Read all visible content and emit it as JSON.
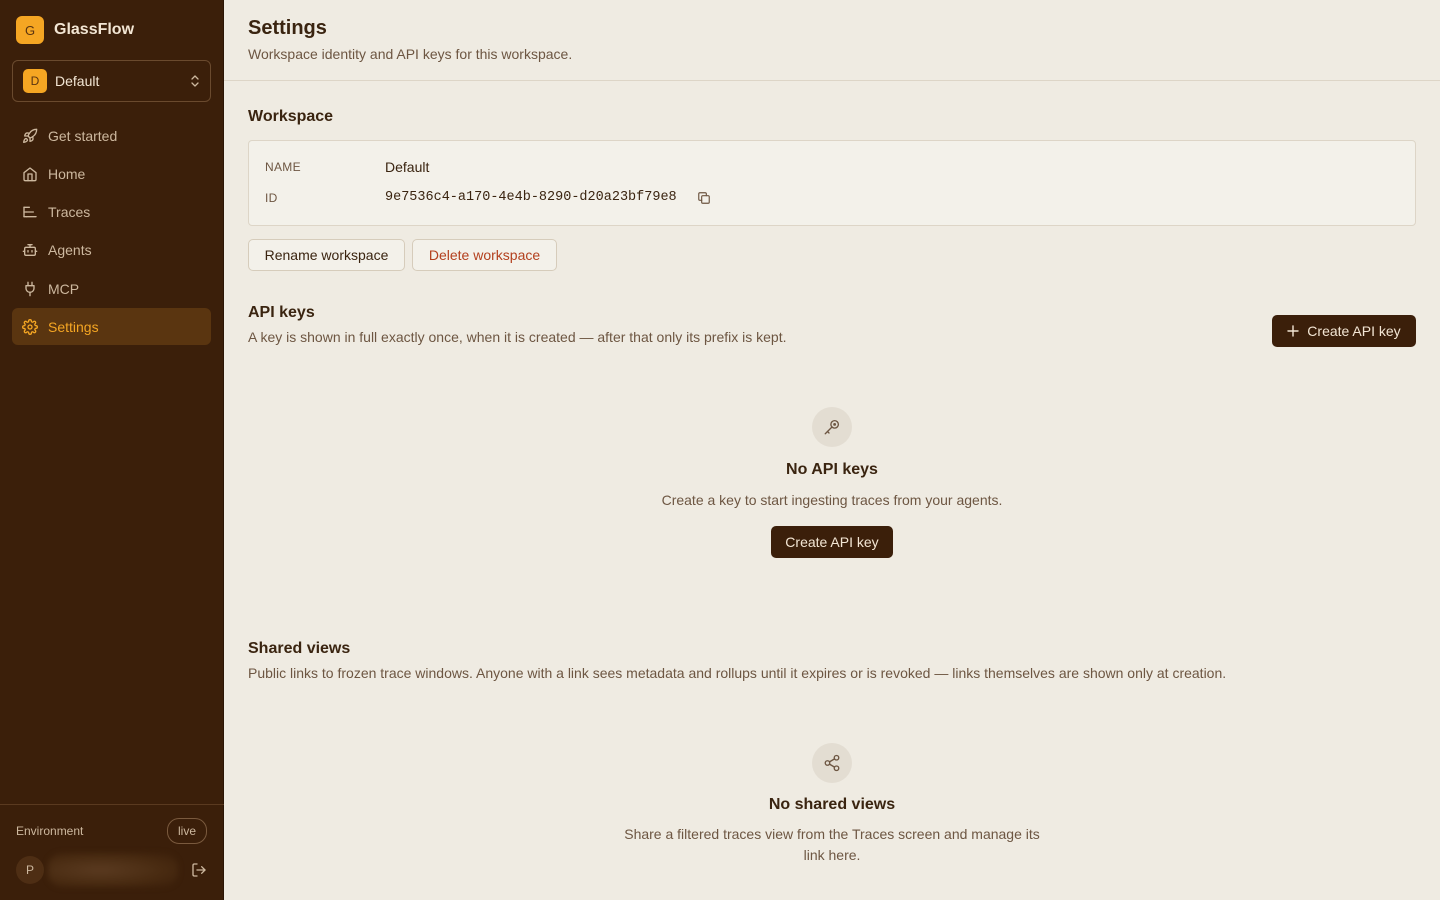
{
  "sidebar": {
    "brand": {
      "logo_letter": "G",
      "name": "GlassFlow"
    },
    "workspace_switcher": {
      "badge_letter": "D",
      "name": "Default"
    },
    "items": [
      {
        "label": "Get started",
        "icon": "rocket-icon",
        "active": false
      },
      {
        "label": "Home",
        "icon": "home-icon",
        "active": false
      },
      {
        "label": "Traces",
        "icon": "traces-icon",
        "active": false
      },
      {
        "label": "Agents",
        "icon": "bot-icon",
        "active": false
      },
      {
        "label": "MCP",
        "icon": "plug-icon",
        "active": false
      },
      {
        "label": "Settings",
        "icon": "gear-icon",
        "active": true
      }
    ],
    "environment": {
      "label": "Environment",
      "value": "live"
    },
    "user": {
      "avatar_letter": "P"
    }
  },
  "header": {
    "title": "Settings",
    "subtitle": "Workspace identity and API keys for this workspace."
  },
  "workspace": {
    "heading": "Workspace",
    "name_label": "NAME",
    "name_value": "Default",
    "id_label": "ID",
    "id_value": "9e7536c4-a170-4e4b-8290-d20a23bf79e8",
    "rename_label": "Rename workspace",
    "delete_label": "Delete workspace"
  },
  "api_keys": {
    "heading": "API keys",
    "description": "A key is shown in full exactly once, when it is created — after that only its prefix is kept.",
    "create_button_label": "Create API key",
    "empty_title": "No API keys",
    "empty_text": "Create a key to start ingesting traces from your agents.",
    "empty_button_label": "Create API key"
  },
  "shared_views": {
    "heading": "Shared views",
    "description": "Public links to frozen trace windows. Anyone with a link sees metadata and rollups until it expires or is revoked — links themselves are shown only at creation.",
    "empty_title": "No shared views",
    "empty_text": "Share a filtered traces view from the Traces screen and manage its link here."
  },
  "colors": {
    "sidebar_bg": "#3b1f0a",
    "accent": "#f5a623",
    "main_bg": "#efebe2",
    "danger": "#b3401e"
  }
}
